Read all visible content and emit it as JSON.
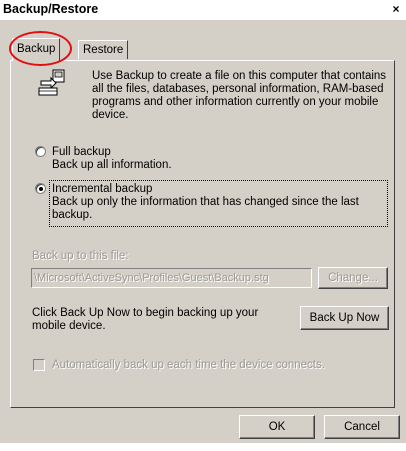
{
  "window": {
    "title": "Backup/Restore",
    "close_glyph": "×"
  },
  "tabs": [
    {
      "label": "Backup",
      "active": true
    },
    {
      "label": "Restore",
      "active": false
    }
  ],
  "intro": {
    "icon": "backup-icon",
    "lines": [
      "Use Backup to create a file on this computer that contains",
      "all the files, databases, personal information, RAM-based",
      "programs and other information currently on your mobile",
      "device."
    ]
  },
  "full_backup": {
    "label": "Full backup",
    "description": "Back up all information.",
    "selected": false
  },
  "incremental_backup": {
    "label": "Incremental backup",
    "description_lines": [
      "Back up only the information that has changed since the last",
      "backup."
    ],
    "selected": true
  },
  "backup_file": {
    "label": "Back up to this file:",
    "value": "\\Microsoft\\ActiveSync\\Profiles\\Guest\\Backup.stg",
    "change_label": "Change..."
  },
  "backup_now": {
    "instruction_lines": [
      "Click Back Up Now to begin backing up your",
      "mobile device."
    ],
    "button_label": "Back Up Now"
  },
  "auto_backup": {
    "label": "Automatically back up each time the device connects.",
    "checked": false
  },
  "buttons": {
    "ok": "OK",
    "cancel": "Cancel"
  },
  "colors": {
    "face": "#d4d0c8",
    "highlight_ring": "#e01010",
    "disabled_text": "#9c9a94"
  }
}
